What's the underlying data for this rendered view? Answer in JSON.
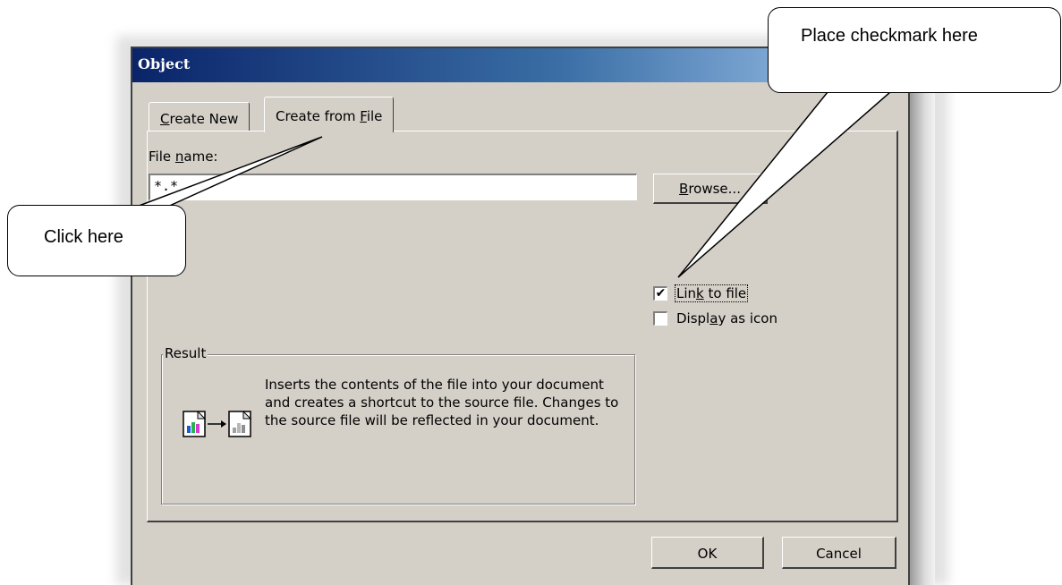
{
  "dialog": {
    "title": "Object",
    "tabs": [
      {
        "label_pre": "",
        "label_accel": "C",
        "label_post": "reate New"
      },
      {
        "label_pre": "Create from ",
        "label_accel": "F",
        "label_post": "ile"
      }
    ],
    "file_name_label_pre": "File ",
    "file_name_label_accel": "n",
    "file_name_label_post": "ame:",
    "file_name_value": "*.*",
    "browse_label_accel": "B",
    "browse_label_post": "rowse...",
    "link_to_file": {
      "label_pre": "Lin",
      "label_accel": "k",
      "label_post": " to file",
      "checked": "✔"
    },
    "display_as_icon": {
      "label_pre": "Displ",
      "label_accel": "a",
      "label_post": "y as icon",
      "checked": ""
    },
    "result_legend": "Result",
    "result_text": "Inserts the contents of the file into your document and creates a shortcut to the source file.  Changes to the source file will be reflected in your document.",
    "ok_label": "OK",
    "cancel_label": "Cancel"
  },
  "callouts": {
    "place_checkmark": "Place checkmark here",
    "click_here": "Click here"
  },
  "colors": {
    "dialog_bg": "#d4d0c8",
    "title_start": "#0a246a",
    "title_end": "#a6caf0"
  }
}
